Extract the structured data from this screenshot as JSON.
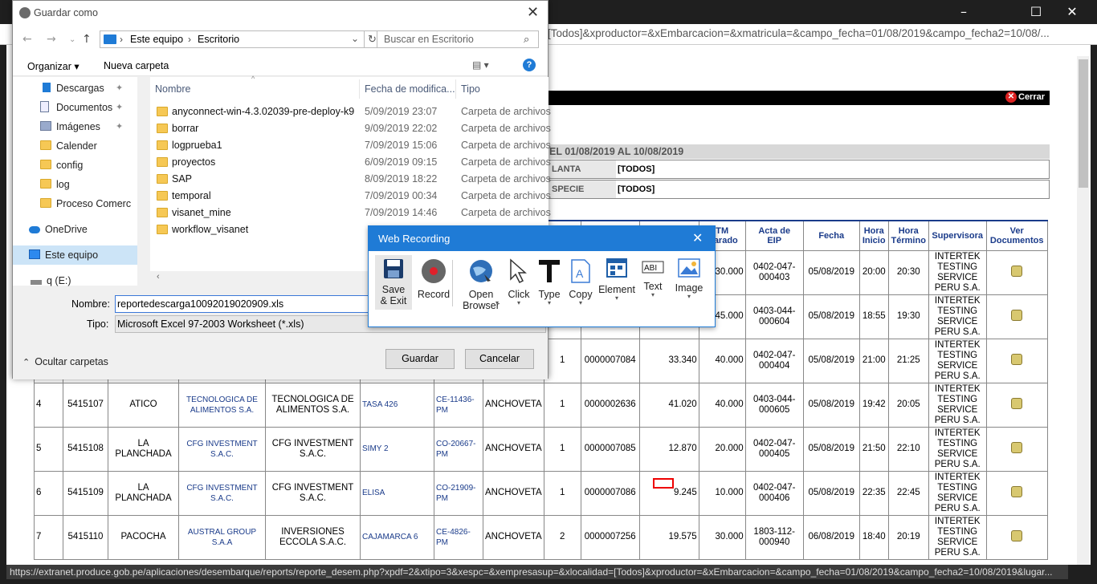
{
  "browser": {
    "url_partial": "[Todos]&xproductor=&xEmbarcacion=&xmatricula=&campo_fecha=01/08/2019&campo_fecha2=10/08/...",
    "status_url": "https://extranet.produce.gob.pe/aplicaciones/desembarque/reports/reporte_desem.php?xpdf=2&xtipo=3&xespc=&xempresasup=&xlocalidad=[Todos]&xproductor=&xEmbarcacion=&campo_fecha=01/08/2019&campo_fecha2=10/08/2019&lugar..."
  },
  "report": {
    "cerrar": "Cerrar",
    "subtitle": "EL 01/08/2019 AL 10/08/2019",
    "filters": [
      {
        "label": "LANTA",
        "value": "[TODOS]"
      },
      {
        "label": "SPECIE",
        "value": "[TODOS]"
      }
    ],
    "headers": [
      "",
      "",
      "",
      "",
      "",
      "",
      "",
      "",
      "",
      "",
      "TM\nclarado",
      "Acta de\nEIP",
      "Fecha",
      "Hora\nInicio",
      "Hora\nTérmino",
      "Supervisora",
      "Ver\nDocumentos"
    ],
    "headers_partial": [
      "",
      "",
      "",
      "",
      "",
      "",
      "",
      "",
      "",
      "",
      "TM\nclarado",
      "Acta de\nEIP",
      "Fecha",
      "Hora\nInicio",
      "Hora\nTérmino",
      "Supervisora",
      "Ver\nDocumentos"
    ],
    "rows_partial": [
      {
        "tm": "30.000",
        "acta": "0402-047-000403",
        "fecha": "05/08/2019",
        "hi": "20:00",
        "ht": "20:30",
        "sup": "INTERTEK TESTING SERVICE PERU S.A."
      },
      {
        "tm": "45.000",
        "acta": "0403-044-000604",
        "fecha": "05/08/2019",
        "hi": "18:55",
        "ht": "19:30",
        "sup": "INTERTEK TESTING SERVICE PERU S.A."
      }
    ],
    "rows": [
      {
        "n": "",
        "cod": "",
        "lugar": "",
        "empresa": "",
        "armador": "",
        "emb": "",
        "matr": "",
        "especie": "",
        "viaje": "1",
        "num": "0000007084",
        "tm_desc": "33.340",
        "tm": "40.000",
        "acta": "0402-047-000404",
        "fecha": "05/08/2019",
        "hi": "21:00",
        "ht": "21:25",
        "sup": "INTERTEK TESTING SERVICE PERU S.A."
      },
      {
        "n": "4",
        "cod": "5415107",
        "lugar": "ATICO",
        "empresa": "TECNOLOGICA DE ALIMENTOS S.A.",
        "armador": "TECNOLOGICA DE ALIMENTOS S.A.",
        "emb": "TASA 426",
        "matr": "CE-11436-PM",
        "especie": "ANCHOVETA",
        "viaje": "1",
        "num": "0000002636",
        "tm_desc": "41.020",
        "tm": "40.000",
        "acta": "0403-044-000605",
        "fecha": "05/08/2019",
        "hi": "19:42",
        "ht": "20:05",
        "sup": "INTERTEK TESTING SERVICE PERU S.A."
      },
      {
        "n": "5",
        "cod": "5415108",
        "lugar": "LA PLANCHADA",
        "empresa": "CFG INVESTMENT S.A.C.",
        "armador": "CFG INVESTMENT S.A.C.",
        "emb": "SIMY 2",
        "matr": "CO-20667-PM",
        "especie": "ANCHOVETA",
        "viaje": "1",
        "num": "0000007085",
        "tm_desc": "12.870",
        "tm": "20.000",
        "acta": "0402-047-000405",
        "fecha": "05/08/2019",
        "hi": "21:50",
        "ht": "22:10",
        "sup": "INTERTEK TESTING SERVICE PERU S.A."
      },
      {
        "n": "6",
        "cod": "5415109",
        "lugar": "LA PLANCHADA",
        "empresa": "CFG INVESTMENT S.A.C.",
        "armador": "CFG INVESTMENT S.A.C.",
        "emb": "ELISA",
        "matr": "CO-21909-PM",
        "especie": "ANCHOVETA",
        "viaje": "1",
        "num": "0000007086",
        "tm_desc": "9.245",
        "tm": "10.000",
        "acta": "0402-047-000406",
        "fecha": "05/08/2019",
        "hi": "22:35",
        "ht": "22:45",
        "sup": "INTERTEK TESTING SERVICE PERU S.A."
      },
      {
        "n": "7",
        "cod": "5415110",
        "lugar": "PACOCHA",
        "empresa": "AUSTRAL GROUP S.A.A",
        "armador": "INVERSIONES ECCOLA S.A.C.",
        "emb": "CAJAMARCA 6",
        "matr": "CE-4826-PM",
        "especie": "ANCHOVETA",
        "viaje": "2",
        "num": "0000007256",
        "tm_desc": "19.575",
        "tm": "30.000",
        "acta": "1803-112-000940",
        "fecha": "06/08/2019",
        "hi": "18:40",
        "ht": "20:19",
        "sup": "INTERTEK TESTING SERVICE PERU S.A."
      }
    ]
  },
  "dialog": {
    "title": "Guardar como",
    "path": [
      "Este equipo",
      "Escritorio"
    ],
    "search_placeholder": "Buscar en Escritorio",
    "organizar": "Organizar",
    "nueva_carpeta": "Nueva carpeta",
    "nav": [
      {
        "label": "Descargas",
        "icon": "download-icon"
      },
      {
        "label": "Documentos",
        "icon": "documents-icon"
      },
      {
        "label": "Imágenes",
        "icon": "pictures-icon"
      },
      {
        "label": "Calender",
        "icon": "folder-icon"
      },
      {
        "label": "config",
        "icon": "folder-icon"
      },
      {
        "label": "log",
        "icon": "folder-icon"
      },
      {
        "label": "Proceso Comerc",
        "icon": "folder-icon"
      },
      {
        "label": "OneDrive",
        "icon": "cloud-icon"
      },
      {
        "label": "Este equipo",
        "icon": "computer-icon"
      },
      {
        "label": "q (E:)",
        "icon": "drive-icon"
      }
    ],
    "columns": {
      "name": "Nombre",
      "date": "Fecha de modifica...",
      "type": "Tipo"
    },
    "files": [
      {
        "name": "anyconnect-win-4.3.02039-pre-deploy-k9",
        "date": "5/09/2019 23:07",
        "type": "Carpeta de archivos"
      },
      {
        "name": "borrar",
        "date": "9/09/2019 22:02",
        "type": "Carpeta de archivos"
      },
      {
        "name": "logprueba1",
        "date": "7/09/2019 15:06",
        "type": "Carpeta de archivos"
      },
      {
        "name": "proyectos",
        "date": "6/09/2019 09:15",
        "type": "Carpeta de archivos"
      },
      {
        "name": "SAP",
        "date": "8/09/2019 18:22",
        "type": "Carpeta de archivos"
      },
      {
        "name": "temporal",
        "date": "7/09/2019 00:34",
        "type": "Carpeta de archivos"
      },
      {
        "name": "visanet_mine",
        "date": "7/09/2019 14:46",
        "type": "Carpeta de archivos"
      },
      {
        "name": "workflow_visanet",
        "date": "",
        "type": ""
      }
    ],
    "nombre_label": "Nombre:",
    "nombre_value": "reportedescarga10092019020909.xls",
    "tipo_label": "Tipo:",
    "tipo_value": "Microsoft Excel 97-2003 Worksheet (*.xls)",
    "hide_folders": "Ocultar carpetas",
    "save": "Guardar",
    "cancel": "Cancelar"
  },
  "recorder": {
    "title": "Web Recording",
    "buttons": [
      {
        "label": "Save\n& Exit",
        "icon": "floppy-disk-icon"
      },
      {
        "label": "Record",
        "icon": "record-icon"
      },
      {
        "label": "Open\nBrowser",
        "icon": "globe-icon"
      },
      {
        "label": "Click",
        "icon": "cursor-icon"
      },
      {
        "label": "Type",
        "icon": "text-t-icon"
      },
      {
        "label": "Copy",
        "icon": "copy-document-icon"
      },
      {
        "label": "Element",
        "icon": "element-grid-icon"
      },
      {
        "label": "Text",
        "icon": "text-select-icon"
      },
      {
        "label": "Image",
        "icon": "image-icon"
      }
    ]
  }
}
